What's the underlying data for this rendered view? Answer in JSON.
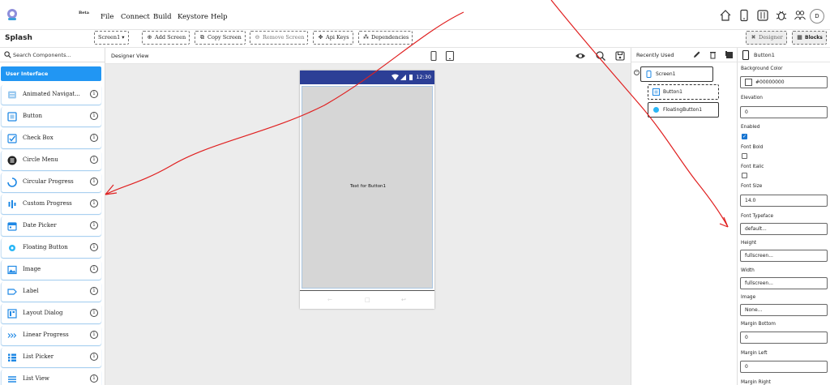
{
  "menu": {
    "beta_label": "Beta",
    "items": [
      "File",
      "Connect",
      "Build",
      "Keystore",
      "Help"
    ],
    "avatar_initial": "D",
    "icons": [
      "home-icon",
      "phone-icon",
      "library-icon",
      "bug-icon",
      "people-icon"
    ]
  },
  "toolbar": {
    "project_name": "Splash",
    "screen_select": "Screen1 ▾",
    "buttons": [
      "Add Screen",
      "Copy Screen",
      "Remove Screen",
      "Api Keys",
      "Dependencies"
    ],
    "designer": "Designer",
    "blocks": "Blocks"
  },
  "palette": {
    "search_placeholder": "Search Components...",
    "category": "User Interface",
    "items": [
      {
        "label": "Animated Navigat...",
        "icon": "animated-navigation-icon"
      },
      {
        "label": "Button",
        "icon": "button-icon"
      },
      {
        "label": "Check Box",
        "icon": "checkbox-icon"
      },
      {
        "label": "Circle Menu",
        "icon": "circle-menu-icon"
      },
      {
        "label": "Circular Progress",
        "icon": "circular-progress-icon"
      },
      {
        "label": "Custom Progress",
        "icon": "custom-progress-icon"
      },
      {
        "label": "Date Picker",
        "icon": "date-picker-icon"
      },
      {
        "label": "Floating Button",
        "icon": "floating-button-icon"
      },
      {
        "label": "Image",
        "icon": "image-icon"
      },
      {
        "label": "Label",
        "icon": "label-icon"
      },
      {
        "label": "Layout Dialog",
        "icon": "layout-dialog-icon"
      },
      {
        "label": "Linear Progress",
        "icon": "linear-progress-icon"
      },
      {
        "label": "List Picker",
        "icon": "list-picker-icon"
      },
      {
        "label": "List View",
        "icon": "list-view-icon"
      }
    ]
  },
  "viewer": {
    "title": "Designer View",
    "status_time": "12:30",
    "button_text": "Text for Button1"
  },
  "tree": {
    "title": "Recently Used",
    "screen": "Screen1",
    "children": [
      "Button1",
      "FloatingButton1"
    ]
  },
  "properties": {
    "component": "Button1",
    "background_color_label": "Background Color",
    "background_color_value": "#00000000",
    "elevation_label": "Elevation",
    "elevation_value": "0",
    "enabled_label": "Enabled",
    "enabled_checked": true,
    "font_bold_label": "Font Bold",
    "font_italic_label": "Font Italic",
    "font_size_label": "Font Size",
    "font_size_value": "14.0",
    "font_typeface_label": "Font Typeface",
    "font_typeface_value": "default...",
    "height_label": "Height",
    "height_value": "fullscreen...",
    "width_label": "Width",
    "width_value": "fullscreen...",
    "image_label": "Image",
    "image_value": "None...",
    "margin_bottom_label": "Margin Bottom",
    "margin_bottom_value": "0",
    "margin_left_label": "Margin Left",
    "margin_left_value": "0",
    "margin_right_label": "Margin Right"
  },
  "colors": {
    "accent": "#2196f3",
    "statusbar": "#2c3f96",
    "canvas": "#ececec",
    "screen": "#d6d6d6",
    "annotation": "#e02020"
  }
}
